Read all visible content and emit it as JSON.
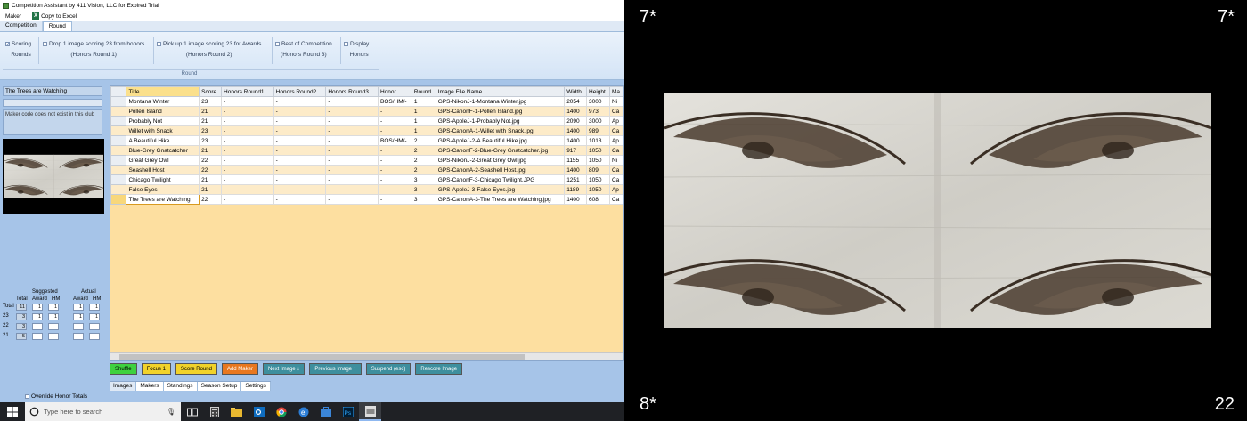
{
  "window": {
    "title": "Competition Assistant by 411 Vision, LLC for Expired Trial"
  },
  "menu": {
    "maker": "Maker",
    "copy_excel": "Copy to Excel"
  },
  "ribbon_tabs": [
    "Competition",
    "Round"
  ],
  "ribbon": {
    "scoring": "Scoring",
    "rounds": "Rounds",
    "drop": "Drop 1 image scoring 23 from honors",
    "drop_sub": "(Honors Round 1)",
    "pickup": "Pick up 1 image scoring 23 for Awards",
    "pickup_sub": "(Honors Round 2)",
    "best": "Best of Competition",
    "best_sub": "(Honors Round 3)",
    "display": "Display",
    "honors": "Honors",
    "group_caption": "Round"
  },
  "side": {
    "title": "The Trees are Watching",
    "message": "Maker code does not exist in this club",
    "stats_header_suggested": "Suggested",
    "stats_header_actual": "Actual",
    "col_total": "Total",
    "col_award": "Award",
    "col_hm": "HM",
    "rows": [
      {
        "label": "Total",
        "total": "11",
        "s_award": "1",
        "s_hm": "1",
        "a_award": "1",
        "a_hm": "1"
      },
      {
        "label": "23",
        "total": "3",
        "s_award": "1",
        "s_hm": "1",
        "a_award": "1",
        "a_hm": "1"
      },
      {
        "label": "22",
        "total": "3",
        "s_award": "",
        "s_hm": "",
        "a_award": "",
        "a_hm": ""
      },
      {
        "label": "21",
        "total": "5",
        "s_award": "",
        "s_hm": "",
        "a_award": "",
        "a_hm": ""
      }
    ],
    "override": "Override Honor Totals"
  },
  "grid": {
    "columns": [
      "Title",
      "Score",
      "Honors Round1",
      "Honors Round2",
      "Honors Round3",
      "Honor",
      "Round",
      "Image File Name",
      "Width",
      "Height",
      "Ma"
    ],
    "rows": [
      [
        "Montana Winter",
        "23",
        "-",
        "-",
        "-",
        "BOS/HM/-",
        "1",
        "GPS-NikonJ-1-Montana Winter.jpg",
        "2054",
        "3000",
        "Ni"
      ],
      [
        "Pollen Island",
        "21",
        "-",
        "-",
        "-",
        "-",
        "1",
        "GPS-CanonF-1-Pollen Island.jpg",
        "1400",
        "973",
        "Ca"
      ],
      [
        "Probably Not",
        "21",
        "-",
        "-",
        "-",
        "-",
        "1",
        "GPS-AppleJ-1-Probably Not.jpg",
        "2090",
        "3000",
        "Ap"
      ],
      [
        "Willet with Snack",
        "23",
        "-",
        "-",
        "-",
        "-",
        "1",
        "GPS-CanonA-1-Willet with Snack.jpg",
        "1400",
        "989",
        "Ca"
      ],
      [
        "A Beautiful Hike",
        "23",
        "-",
        "-",
        "-",
        "BOS/HM/-",
        "2",
        "GPS-AppleJ-2-A Beautiful Hike.jpg",
        "1400",
        "1013",
        "Ap"
      ],
      [
        "Blue-Grey Gnatcatcher",
        "21",
        "-",
        "-",
        "-",
        "-",
        "2",
        "GPS-CanonF-2-Blue-Grey Gnatcatcher.jpg",
        "917",
        "1050",
        "Ca"
      ],
      [
        "Great Grey Owl",
        "22",
        "-",
        "-",
        "-",
        "-",
        "2",
        "GPS-NikonJ-2-Great Grey Owl.jpg",
        "1155",
        "1050",
        "Ni"
      ],
      [
        "Seashell Host",
        "22",
        "-",
        "-",
        "-",
        "-",
        "2",
        "GPS-CanonA-2-Seashell Host.jpg",
        "1400",
        "809",
        "Ca"
      ],
      [
        "Chicago Twilight",
        "21",
        "-",
        "-",
        "-",
        "-",
        "3",
        "GPS-CanonF-3-Chicago Twilight.JPG",
        "1251",
        "1050",
        "Ca"
      ],
      [
        "False Eyes",
        "21",
        "-",
        "-",
        "-",
        "-",
        "3",
        "GPS-AppleJ-3-False Eyes.jpg",
        "1189",
        "1050",
        "Ap"
      ],
      [
        "The Trees are Watching",
        "22",
        "-",
        "-",
        "-",
        "-",
        "3",
        "GPS-CanonA-3-The Trees are Watching.jpg",
        "1400",
        "608",
        "Ca"
      ]
    ]
  },
  "buttons": {
    "shuffle": "Shuffle",
    "focus": "Focus 1",
    "score_round": "Score Round",
    "add_maker": "Add Maker",
    "next_image": "Next Image ↓",
    "previous_image": "Previous Image ↑",
    "suspend": "Suspend (esc)",
    "rescore": "Rescore Image"
  },
  "view_tabs": [
    "Images",
    "Makers",
    "Standings",
    "Season Setup",
    "Settings"
  ],
  "taskbar": {
    "search_placeholder": "Type here to search"
  },
  "projector": {
    "top_left": "7*",
    "top_right": "7*",
    "bottom_left": "8*",
    "bottom_right": "22"
  }
}
